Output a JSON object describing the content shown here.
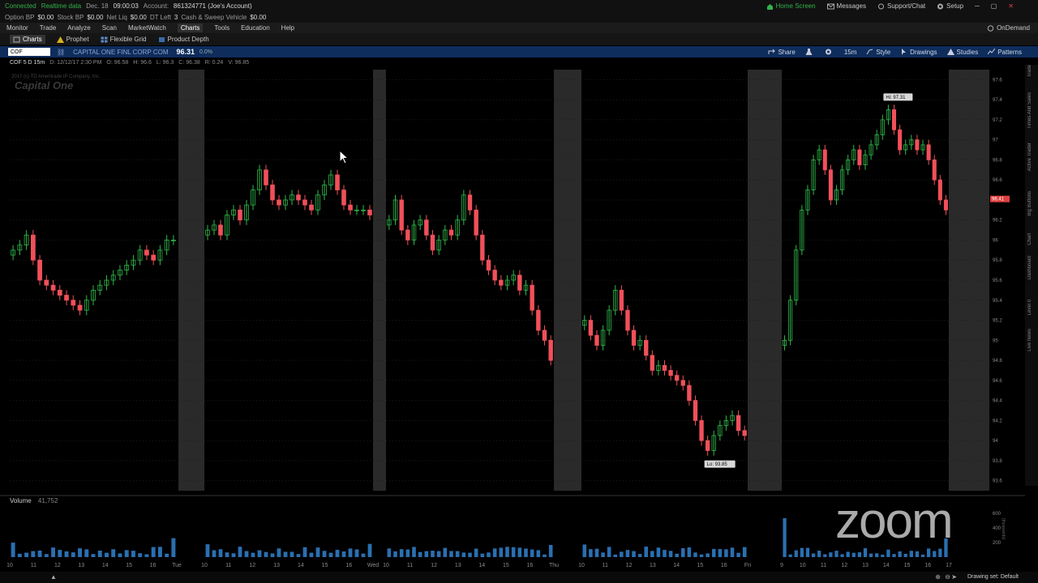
{
  "status": {
    "connected": "Connected",
    "realtime": "Realtime data",
    "date": "Dec. 18",
    "time": "09:00:03",
    "account_label": "Account:",
    "account": "861324771 (Joe's Account)"
  },
  "account_bar": [
    {
      "label": "Option BP",
      "value": "$0.00"
    },
    {
      "label": "Stock BP",
      "value": "$0.00"
    },
    {
      "label": "Net Liq",
      "value": "$0.00"
    },
    {
      "label": "DT Left",
      "value": "3"
    },
    {
      "label": "Cash & Sweep Vehicle",
      "value": "$0.00"
    }
  ],
  "top_right": {
    "home": "Home Screen",
    "messages": "Messages",
    "support": "Support/Chat",
    "setup": "Setup"
  },
  "menu": [
    "Monitor",
    "Trade",
    "Analyze",
    "Scan",
    "MarketWatch",
    "Charts",
    "Tools",
    "Education",
    "Help"
  ],
  "menu_active": "Charts",
  "on_demand": "OnDemand",
  "sub_tabs": [
    "Charts",
    "Prophet",
    "Flexible Grid",
    "Product Depth"
  ],
  "symbol": {
    "value": "COF",
    "company": "CAPITAL ONE FINL CORP COM",
    "price": "96.31",
    "change": "0.0%"
  },
  "chart_tools": [
    "Share",
    "15m",
    "Style",
    "Drawings",
    "Studies",
    "Patterns"
  ],
  "ohlc": {
    "desc": "COF 5 D 15m",
    "date": "D: 12/12/17 2:30 PM",
    "open": "O: 96.58",
    "high": "H: 96.6",
    "low": "L: 96.3",
    "close": "C: 96.38",
    "range": "R: 0.24",
    "v": "V: 96.85"
  },
  "watermark": {
    "copyright": "2017 (c) TD Ameritrade IP Company, Inc.",
    "logo": "Capital One"
  },
  "volume": {
    "label": "Volume",
    "value": "41,752"
  },
  "right_tabs": [
    "Trade",
    "Times And Sales",
    "Active Trader",
    "Big Buttons",
    "Chart",
    "Dashboard",
    "Level II",
    "Live News"
  ],
  "drawing_set": "Drawing set: Default",
  "zoom": "zoom",
  "chart_data": {
    "type": "candlestick",
    "symbol": "COF",
    "interval": "15m",
    "ylim": [
      93.5,
      97.7
    ],
    "y_ticks": [
      93.6,
      93.8,
      94,
      94.2,
      94.4,
      94.6,
      94.8,
      95,
      95.2,
      95.4,
      95.6,
      95.8,
      96,
      96.2,
      96.4,
      96.6,
      96.8,
      97,
      97.2,
      97.4,
      97.6
    ],
    "y_tick_labels": [
      "93.6",
      "93.8",
      "94",
      "94.2",
      "94.4",
      "94.6",
      "94.8",
      "95",
      "95.2",
      "95.4",
      "95.6",
      "95.8",
      "96",
      "96.2",
      "96.4",
      "96.6",
      "96.8",
      "97",
      "97.2",
      "97.4",
      "97.6"
    ],
    "x_labels": [
      "10",
      "11",
      "12",
      "13",
      "14",
      "15",
      "16",
      "Tue",
      "10",
      "11",
      "12",
      "13",
      "14",
      "15",
      "16",
      "Wed",
      "10",
      "11",
      "12",
      "13",
      "14",
      "15",
      "16",
      "Thu",
      "10",
      "11",
      "12",
      "13",
      "14",
      "15",
      "16",
      "Fri",
      "9",
      "10",
      "11",
      "12",
      "13",
      "14",
      "15",
      "16",
      "17"
    ],
    "high_label": "Hi: 97.31",
    "low_label": "Lo: 93.85",
    "current_label": "96.41",
    "volume_ticks": [
      "200",
      "400",
      "600"
    ],
    "volume_units": "(thousands)",
    "days": [
      {
        "close": [
          95.9,
          95.95,
          96.05,
          95.8,
          95.6,
          95.55,
          95.5,
          95.45,
          95.4,
          95.35,
          95.3,
          95.4,
          95.5,
          95.55,
          95.6,
          95.65,
          95.7,
          95.75,
          95.8,
          95.9,
          95.85,
          95.8,
          95.9,
          96.0,
          96.0
        ]
      },
      {
        "close": [
          96.1,
          96.15,
          96.05,
          96.25,
          96.3,
          96.2,
          96.35,
          96.5,
          96.7,
          96.55,
          96.4,
          96.35,
          96.4,
          96.45,
          96.4,
          96.35,
          96.3,
          96.45,
          96.55,
          96.65,
          96.5,
          96.35,
          96.3,
          96.3,
          96.3,
          96.25
        ]
      },
      {
        "close": [
          96.2,
          96.4,
          96.1,
          96.0,
          96.15,
          96.2,
          96.05,
          95.9,
          96.0,
          96.1,
          96.05,
          96.2,
          96.45,
          96.3,
          96.05,
          95.8,
          95.7,
          95.6,
          95.55,
          95.6,
          95.65,
          95.5,
          95.55,
          95.3,
          95.1,
          95.0,
          94.8
        ]
      },
      {
        "close": [
          95.2,
          95.05,
          94.95,
          95.1,
          95.3,
          95.5,
          95.3,
          95.1,
          94.95,
          95.0,
          94.85,
          94.7,
          94.75,
          94.7,
          94.65,
          94.6,
          94.55,
          94.4,
          94.2,
          94.0,
          93.9,
          94.05,
          94.15,
          94.2,
          94.25,
          94.1,
          94.05
        ]
      },
      {
        "close": [
          95.0,
          95.4,
          95.9,
          96.3,
          96.5,
          96.8,
          96.9,
          96.7,
          96.4,
          96.5,
          96.7,
          96.8,
          96.9,
          96.75,
          96.85,
          96.95,
          97.05,
          97.2,
          97.3,
          97.1,
          96.9,
          96.95,
          97.0,
          96.9,
          96.95,
          96.8,
          96.6,
          96.4,
          96.3
        ]
      }
    ]
  }
}
